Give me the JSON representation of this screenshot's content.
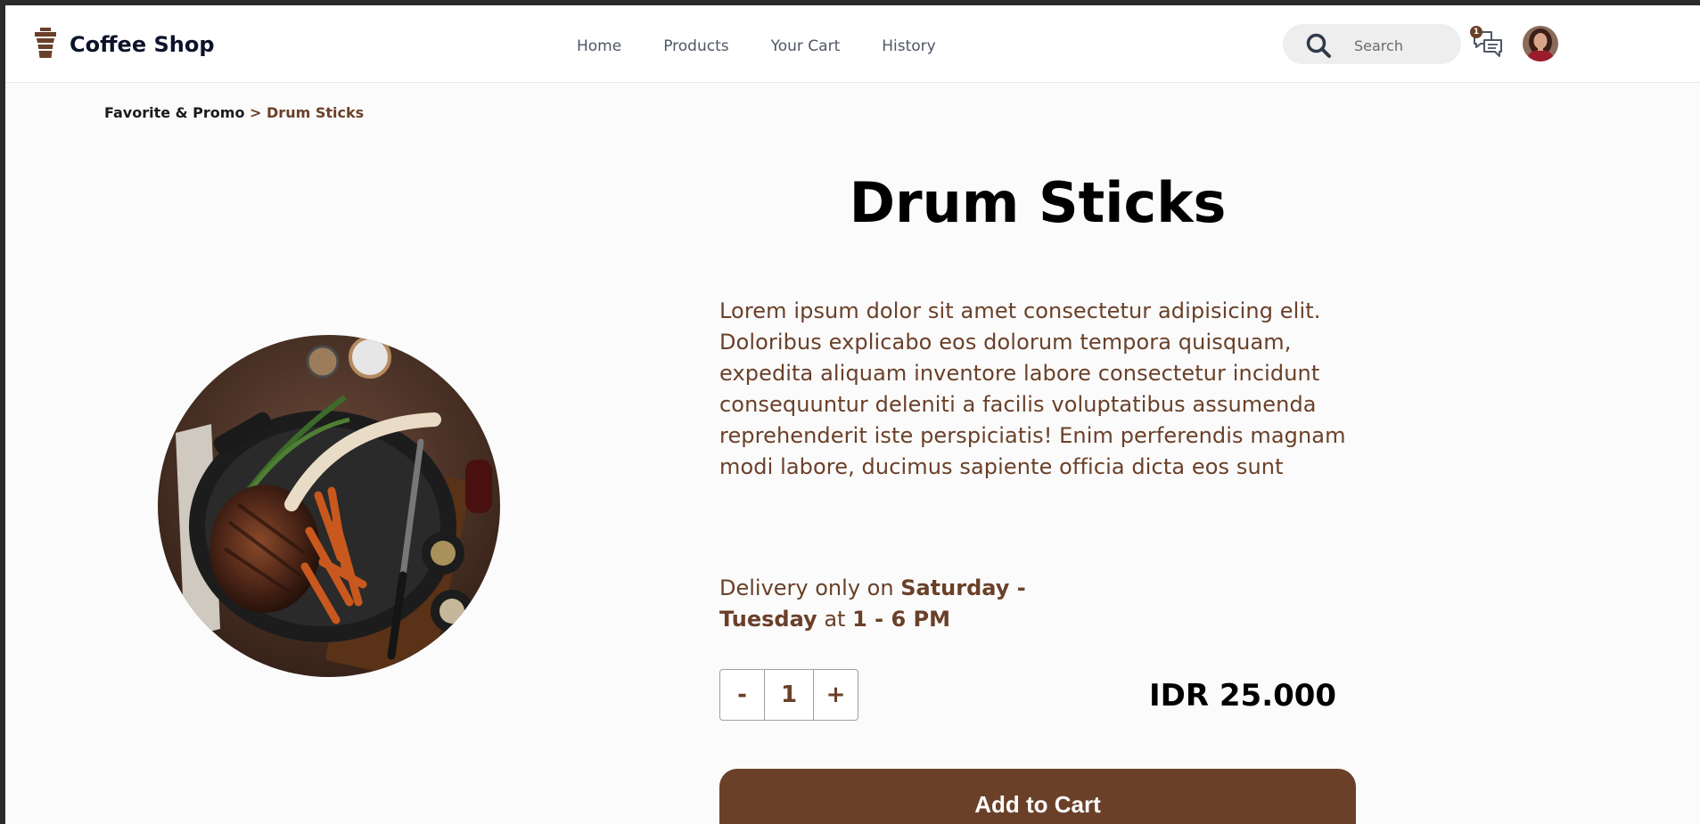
{
  "app": {
    "name": "Coffee Shop",
    "icon": "coffee-cup-icon",
    "brand_color": "#6a4029"
  },
  "nav": {
    "items": [
      {
        "label": "Home"
      },
      {
        "label": "Products"
      },
      {
        "label": "Your Cart"
      },
      {
        "label": "History"
      }
    ]
  },
  "search": {
    "placeholder": "Search",
    "icon": "search-icon"
  },
  "chat": {
    "icon": "chat-icon",
    "badge_count": "1"
  },
  "avatar": {
    "icon": "user-avatar"
  },
  "breadcrumb": {
    "parent": "Favorite & Promo",
    "separator": ">",
    "current": "Drum Sticks"
  },
  "product": {
    "name": "Drum Sticks",
    "image": "steak-dish-image",
    "description": "Lorem ipsum dolor sit amet consectetur adipisicing elit. Doloribus explicabo eos dolorum tempora quisquam, expedita aliquam inventore labore consectetur incidunt consequuntur deleniti a facilis voluptatibus assumenda reprehenderit iste perspiciatis! Enim perferendis magnam modi labore, ducimus sapiente officia dicta eos sunt",
    "delivery": {
      "prefix": "Delivery only on",
      "days": "Saturday - Tuesday",
      "middle": "at",
      "hours": "1 - 6 PM"
    },
    "price": "IDR 25.000"
  },
  "quantity": {
    "minus_label": "-",
    "value": "1",
    "plus_label": "+"
  },
  "actions": {
    "add_to_cart": "Add to Cart"
  }
}
